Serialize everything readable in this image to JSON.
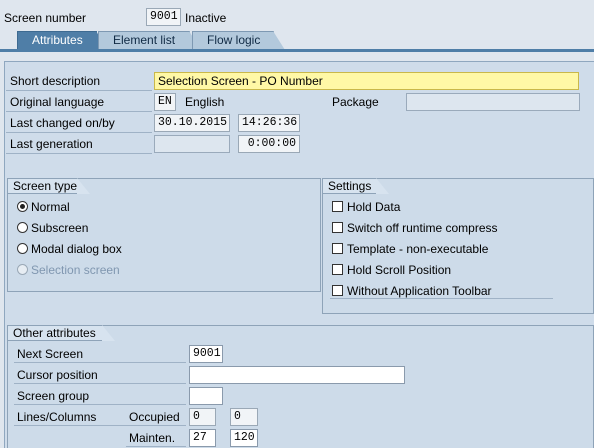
{
  "header": {
    "screen_number_label": "Screen number",
    "screen_number": "9001",
    "status": "Inactive"
  },
  "tabs": [
    {
      "label": "Attributes",
      "active": true
    },
    {
      "label": "Element list",
      "active": false
    },
    {
      "label": "Flow logic",
      "active": false
    }
  ],
  "attributes": {
    "short_description_label": "Short description",
    "short_description": "Selection Screen - PO Number",
    "original_language_label": "Original language",
    "language_code": "EN",
    "language_name": "English",
    "package_label": "Package",
    "package": "",
    "last_changed_label": "Last changed on/by",
    "last_changed_date": "30.10.2015",
    "last_changed_time": "14:26:36",
    "last_generation_label": "Last generation",
    "last_generation_date": "",
    "last_generation_time": "0:00:00"
  },
  "screen_type": {
    "title": "Screen type",
    "options": [
      {
        "label": "Normal",
        "selected": true,
        "enabled": true
      },
      {
        "label": "Subscreen",
        "selected": false,
        "enabled": true
      },
      {
        "label": "Modal dialog box",
        "selected": false,
        "enabled": true
      },
      {
        "label": "Selection screen",
        "selected": false,
        "enabled": false
      }
    ]
  },
  "settings": {
    "title": "Settings",
    "options": [
      {
        "label": "Hold Data",
        "checked": false
      },
      {
        "label": "Switch off runtime compress",
        "checked": false
      },
      {
        "label": "Template - non-executable",
        "checked": false
      },
      {
        "label": "Hold Scroll Position",
        "checked": false
      },
      {
        "label": "Without Application Toolbar",
        "checked": false
      }
    ]
  },
  "other_attributes": {
    "title": "Other attributes",
    "next_screen_label": "Next Screen",
    "next_screen": "9001",
    "cursor_position_label": "Cursor position",
    "cursor_position": "",
    "screen_group_label": "Screen group",
    "screen_group": "",
    "lines_columns_label": "Lines/Columns",
    "occupied_label": "Occupied",
    "occupied_lines": "0",
    "occupied_columns": "0",
    "mainten_label": "Mainten.",
    "mainten_lines": "27",
    "mainten_columns": "120"
  },
  "colors": {
    "tab_active": "#4f7ea7",
    "panel_bg": "#cfdcea",
    "required_field": "#fff8a6"
  }
}
